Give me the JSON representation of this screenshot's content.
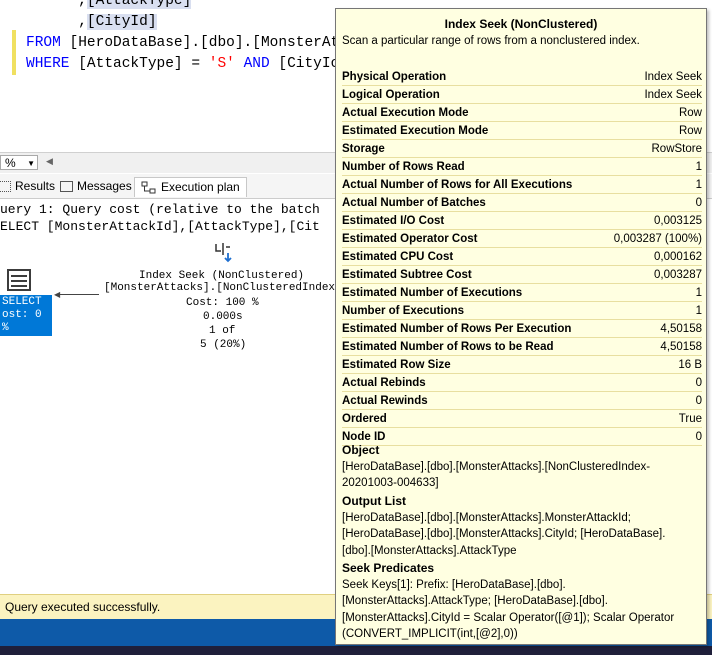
{
  "editor": {
    "lines": [
      {
        "pre": "      ,",
        "text": "[AttackType]"
      },
      {
        "pre": "      ,",
        "text": "[CityId]"
      }
    ],
    "from_kw": "FROM",
    "from_text": "[HeroDataBase].[dbo].[MonsterAt",
    "where_kw": "WHERE",
    "where_field": "[AttackType]",
    "where_eq": " = ",
    "where_val": "'S'",
    "where_and": "AND",
    "where_field2": "[CityIc"
  },
  "zoom": {
    "value": "%"
  },
  "tabs": [
    {
      "label": "Results",
      "icon": "grid-icon"
    },
    {
      "label": "Messages",
      "icon": "messages-icon"
    },
    {
      "label": "Execution plan",
      "icon": "plan-icon",
      "active": true
    }
  ],
  "plan": {
    "query_line1": "uery 1: Query cost (relative to the batch",
    "query_line2": "ELECT [MonsterAttackId],[AttackType],[Cit",
    "select_label": "SELECT",
    "select_cost": "ost: 0 %",
    "seek_title": "Index Seek (NonClustered)",
    "seek_object": "[MonsterAttacks].[NonClusteredIndex",
    "seek_cost": "Cost: 100 %",
    "seek_time": "0.000s",
    "seek_rows": "1 of",
    "seek_pct": "5 (20%)"
  },
  "status": {
    "text": "Query executed successfully."
  },
  "tooltip": {
    "title": "Index Seek (NonClustered)",
    "description": "Scan a particular range of rows from a nonclustered index.",
    "rows": [
      {
        "label": "Physical Operation",
        "value": "Index Seek"
      },
      {
        "label": "Logical Operation",
        "value": "Index Seek"
      },
      {
        "label": "Actual Execution Mode",
        "value": "Row"
      },
      {
        "label": "Estimated Execution Mode",
        "value": "Row"
      },
      {
        "label": "Storage",
        "value": "RowStore"
      },
      {
        "label": "Number of Rows Read",
        "value": "1"
      },
      {
        "label": "Actual Number of Rows for All Executions",
        "value": "1"
      },
      {
        "label": "Actual Number of Batches",
        "value": "0"
      },
      {
        "label": "Estimated I/O Cost",
        "value": "0,003125"
      },
      {
        "label": "Estimated Operator Cost",
        "value": "0,003287 (100%)"
      },
      {
        "label": "Estimated CPU Cost",
        "value": "0,000162"
      },
      {
        "label": "Estimated Subtree Cost",
        "value": "0,003287"
      },
      {
        "label": "Estimated Number of Executions",
        "value": "1"
      },
      {
        "label": "Number of Executions",
        "value": "1"
      },
      {
        "label": "Estimated Number of Rows Per Execution",
        "value": "4,50158"
      },
      {
        "label": "Estimated Number of Rows to be Read",
        "value": "4,50158"
      },
      {
        "label": "Estimated Row Size",
        "value": "16 B"
      },
      {
        "label": "Actual Rebinds",
        "value": "0"
      },
      {
        "label": "Actual Rewinds",
        "value": "0"
      },
      {
        "label": "Ordered",
        "value": "True"
      },
      {
        "label": "Node ID",
        "value": "0"
      }
    ],
    "object_heading": "Object",
    "object_lines": [
      "[HeroDataBase].[dbo].[MonsterAttacks].[NonClusteredIndex-",
      "20201003-004633]"
    ],
    "output_heading": "Output List",
    "output_lines": [
      "[HeroDataBase].[dbo].[MonsterAttacks].MonsterAttackId;",
      "[HeroDataBase].[dbo].[MonsterAttacks].CityId; [HeroDataBase].",
      "[dbo].[MonsterAttacks].AttackType"
    ],
    "seek_heading": "Seek Predicates",
    "seek_lines": [
      "Seek Keys[1]: Prefix: [HeroDataBase].[dbo].",
      "[MonsterAttacks].AttackType; [HeroDataBase].[dbo].",
      "[MonsterAttacks].CityId = Scalar Operator([@1]); Scalar Operator",
      "(CONVERT_IMPLICIT(int,[@2],0))"
    ]
  }
}
